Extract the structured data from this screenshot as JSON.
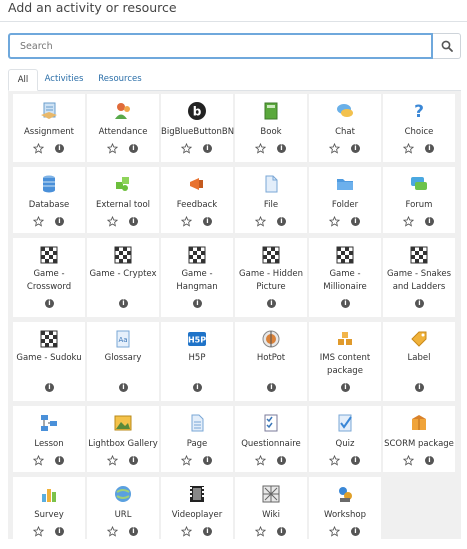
{
  "modal": {
    "title": "Add an activity or resource"
  },
  "search": {
    "placeholder": "Search"
  },
  "tabs": [
    "All",
    "Activities",
    "Resources"
  ],
  "icons": {
    "star": "star-outline-icon",
    "info": "info-icon",
    "search": "search-icon"
  },
  "items": [
    {
      "label": "Assignment",
      "icon": "assignment-icon"
    },
    {
      "label": "Attendance",
      "icon": "attendance-icon"
    },
    {
      "label": "BigBlueButtonBN",
      "icon": "bigbluebutton-icon"
    },
    {
      "label": "Book",
      "icon": "book-icon"
    },
    {
      "label": "Chat",
      "icon": "chat-icon"
    },
    {
      "label": "Choice",
      "icon": "choice-icon"
    },
    {
      "label": "Database",
      "icon": "database-icon"
    },
    {
      "label": "External tool",
      "icon": "external-tool-icon"
    },
    {
      "label": "Feedback",
      "icon": "feedback-icon"
    },
    {
      "label": "File",
      "icon": "file-icon"
    },
    {
      "label": "Folder",
      "icon": "folder-icon"
    },
    {
      "label": "Forum",
      "icon": "forum-icon"
    },
    {
      "label": "Game - Crossword",
      "line1": "Game -",
      "line2": "Crossword",
      "icon": "game-icon"
    },
    {
      "label": "Game - Cryptex",
      "icon": "game-icon"
    },
    {
      "label": "Game - Hangman",
      "line1": "Game -",
      "line2": "Hangman",
      "icon": "game-icon"
    },
    {
      "label": "Game - Hidden Picture",
      "line1": "Game - Hidden",
      "line2": "Picture",
      "icon": "game-icon"
    },
    {
      "label": "Game - Millionaire",
      "line1": "Game -",
      "line2": "Millionaire",
      "icon": "game-icon"
    },
    {
      "label": "Game - Snakes and Ladders",
      "line1": "Game - Snakes",
      "line2": "and Ladders",
      "icon": "game-icon"
    },
    {
      "label": "Game - Sudoku",
      "icon": "game-icon"
    },
    {
      "label": "Glossary",
      "icon": "glossary-icon"
    },
    {
      "label": "H5P",
      "icon": "h5p-icon"
    },
    {
      "label": "HotPot",
      "icon": "hotpot-icon"
    },
    {
      "label": "IMS content package",
      "line1": "IMS content",
      "line2": "package",
      "icon": "ims-package-icon"
    },
    {
      "label": "Label",
      "icon": "label-icon"
    },
    {
      "label": "Lesson",
      "icon": "lesson-icon"
    },
    {
      "label": "Lightbox Gallery",
      "icon": "lightbox-gallery-icon"
    },
    {
      "label": "Page",
      "icon": "page-icon"
    },
    {
      "label": "Questionnaire",
      "icon": "questionnaire-icon"
    },
    {
      "label": "Quiz",
      "icon": "quiz-icon"
    },
    {
      "label": "SCORM package",
      "icon": "scorm-icon"
    },
    {
      "label": "Survey",
      "icon": "survey-icon"
    },
    {
      "label": "URL",
      "icon": "url-icon"
    },
    {
      "label": "Videoplayer",
      "icon": "videoplayer-icon"
    },
    {
      "label": "Wiki",
      "icon": "wiki-icon"
    },
    {
      "label": "Workshop",
      "icon": "workshop-icon"
    }
  ]
}
